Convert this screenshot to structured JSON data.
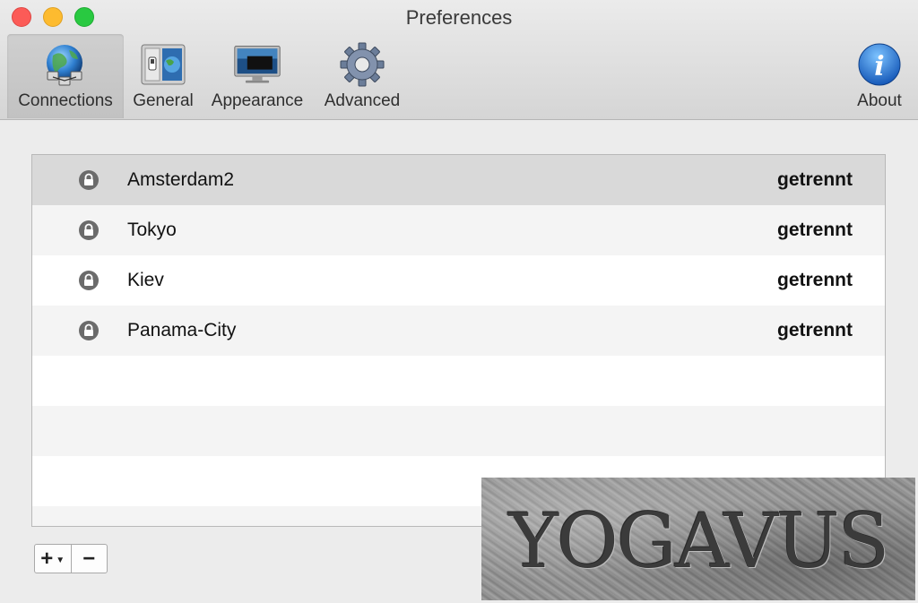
{
  "window": {
    "title": "Preferences"
  },
  "toolbar": {
    "items": [
      {
        "label": "Connections",
        "icon": "globe-network-icon"
      },
      {
        "label": "General",
        "icon": "switch-panel-icon"
      },
      {
        "label": "Appearance",
        "icon": "monitor-icon"
      },
      {
        "label": "Advanced",
        "icon": "gear-icon"
      },
      {
        "label": "About",
        "icon": "info-icon"
      }
    ],
    "selected": "Connections"
  },
  "connections": {
    "rows": [
      {
        "name": "Amsterdam2",
        "status": "getrennt",
        "icon": "lock-icon"
      },
      {
        "name": "Tokyo",
        "status": "getrennt",
        "icon": "lock-icon"
      },
      {
        "name": "Kiev",
        "status": "getrennt",
        "icon": "lock-icon"
      },
      {
        "name": "Panama-City",
        "status": "getrennt",
        "icon": "lock-icon"
      }
    ]
  },
  "buttons": {
    "add": "+",
    "remove": "−"
  },
  "watermark": {
    "text": "YOGAVUS"
  },
  "colors": {
    "close": "#fc5b57",
    "minimize": "#fdbb2f",
    "maximize": "#29c941",
    "selected_row": "#d9d9d9"
  }
}
